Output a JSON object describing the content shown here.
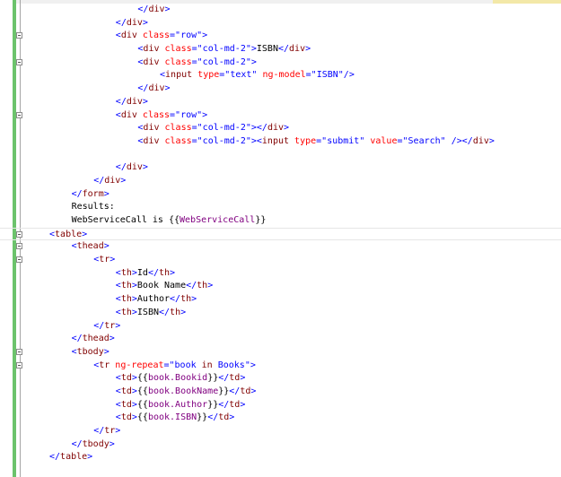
{
  "colors": {
    "tag_delimiter": "#0000ff",
    "tag_name": "#800000",
    "attribute": "#ff0000",
    "attribute_value": "#0000ff",
    "text": "#000000",
    "binding": "#800080",
    "change_bar": "#6cc36c"
  },
  "fold_icon": "collapse-box-icon",
  "lines": [
    {
      "indent": 8,
      "fold": false,
      "tokens": [
        [
          "t",
          "</"
        ],
        [
          "tag",
          "div"
        ],
        [
          "t",
          ">"
        ]
      ]
    },
    {
      "indent": 6,
      "fold": false,
      "tokens": [
        [
          "t",
          "</"
        ],
        [
          "tag",
          "div"
        ],
        [
          "t",
          ">"
        ]
      ]
    },
    {
      "indent": 6,
      "fold": true,
      "tokens": [
        [
          "t",
          "<"
        ],
        [
          "tag",
          "div"
        ],
        [
          "txt",
          " "
        ],
        [
          "attr",
          "class"
        ],
        [
          "t",
          "=\""
        ],
        [
          "val",
          "row"
        ],
        [
          "t",
          "\">"
        ]
      ]
    },
    {
      "indent": 8,
      "fold": false,
      "tokens": [
        [
          "t",
          "<"
        ],
        [
          "tag",
          "div"
        ],
        [
          "txt",
          " "
        ],
        [
          "attr",
          "class"
        ],
        [
          "t",
          "=\""
        ],
        [
          "val",
          "col-md-2"
        ],
        [
          "t",
          "\">"
        ],
        [
          "txt",
          "ISBN"
        ],
        [
          "t",
          "</"
        ],
        [
          "tag",
          "div"
        ],
        [
          "t",
          ">"
        ]
      ]
    },
    {
      "indent": 8,
      "fold": true,
      "tokens": [
        [
          "t",
          "<"
        ],
        [
          "tag",
          "div"
        ],
        [
          "txt",
          " "
        ],
        [
          "attr",
          "class"
        ],
        [
          "t",
          "=\""
        ],
        [
          "val",
          "col-md-2"
        ],
        [
          "t",
          "\">"
        ]
      ]
    },
    {
      "indent": 10,
      "fold": false,
      "tokens": [
        [
          "t",
          "<"
        ],
        [
          "tag",
          "input"
        ],
        [
          "txt",
          " "
        ],
        [
          "attr",
          "type"
        ],
        [
          "t",
          "=\""
        ],
        [
          "val",
          "text"
        ],
        [
          "t",
          "\""
        ],
        [
          "txt",
          " "
        ],
        [
          "attr",
          "ng-model"
        ],
        [
          "t",
          "=\""
        ],
        [
          "val",
          "ISBN"
        ],
        [
          "t",
          "\"/>"
        ]
      ]
    },
    {
      "indent": 8,
      "fold": false,
      "tokens": [
        [
          "t",
          "</"
        ],
        [
          "tag",
          "div"
        ],
        [
          "t",
          ">"
        ]
      ]
    },
    {
      "indent": 6,
      "fold": false,
      "tokens": [
        [
          "t",
          "</"
        ],
        [
          "tag",
          "div"
        ],
        [
          "t",
          ">"
        ]
      ]
    },
    {
      "indent": 6,
      "fold": true,
      "tokens": [
        [
          "t",
          "<"
        ],
        [
          "tag",
          "div"
        ],
        [
          "txt",
          " "
        ],
        [
          "attr",
          "class"
        ],
        [
          "t",
          "=\""
        ],
        [
          "val",
          "row"
        ],
        [
          "t",
          "\">"
        ]
      ]
    },
    {
      "indent": 8,
      "fold": false,
      "tokens": [
        [
          "t",
          "<"
        ],
        [
          "tag",
          "div"
        ],
        [
          "txt",
          " "
        ],
        [
          "attr",
          "class"
        ],
        [
          "t",
          "=\""
        ],
        [
          "val",
          "col-md-2"
        ],
        [
          "t",
          "\"></"
        ],
        [
          "tag",
          "div"
        ],
        [
          "t",
          ">"
        ]
      ]
    },
    {
      "indent": 8,
      "fold": false,
      "tokens": [
        [
          "t",
          "<"
        ],
        [
          "tag",
          "div"
        ],
        [
          "txt",
          " "
        ],
        [
          "attr",
          "class"
        ],
        [
          "t",
          "=\""
        ],
        [
          "val",
          "col-md-2"
        ],
        [
          "t",
          "\"><"
        ],
        [
          "tag",
          "input"
        ],
        [
          "txt",
          " "
        ],
        [
          "attr",
          "type"
        ],
        [
          "t",
          "=\""
        ],
        [
          "val",
          "submit"
        ],
        [
          "t",
          "\""
        ],
        [
          "txt",
          " "
        ],
        [
          "attr",
          "value"
        ],
        [
          "t",
          "=\""
        ],
        [
          "val",
          "Search"
        ],
        [
          "t",
          "\""
        ],
        [
          "txt",
          " "
        ],
        [
          "t",
          "/></"
        ],
        [
          "tag",
          "div"
        ],
        [
          "t",
          ">"
        ]
      ]
    },
    {
      "indent": 0,
      "fold": false,
      "tokens": []
    },
    {
      "indent": 6,
      "fold": false,
      "tokens": [
        [
          "t",
          "</"
        ],
        [
          "tag",
          "div"
        ],
        [
          "t",
          ">"
        ]
      ]
    },
    {
      "indent": 4,
      "fold": false,
      "tokens": [
        [
          "t",
          "</"
        ],
        [
          "tag",
          "div"
        ],
        [
          "t",
          ">"
        ]
      ]
    },
    {
      "indent": 2,
      "fold": false,
      "tokens": [
        [
          "t",
          "</"
        ],
        [
          "tag",
          "form"
        ],
        [
          "t",
          ">"
        ]
      ]
    },
    {
      "indent": 2,
      "fold": false,
      "tokens": [
        [
          "txt",
          "Results:"
        ]
      ]
    },
    {
      "indent": 2,
      "fold": false,
      "tokens": [
        [
          "txt",
          "WebServiceCall is {{"
        ],
        [
          "bind",
          "WebServiceCall"
        ],
        [
          "txt",
          "}}"
        ]
      ]
    },
    {
      "indent": 0,
      "fold": true,
      "current": true,
      "tokens": [
        [
          "t",
          "<"
        ],
        [
          "tag",
          "table"
        ],
        [
          "t",
          ">"
        ]
      ]
    },
    {
      "indent": 2,
      "fold": true,
      "tokens": [
        [
          "t",
          "<"
        ],
        [
          "tag",
          "thead"
        ],
        [
          "t",
          ">"
        ]
      ]
    },
    {
      "indent": 4,
      "fold": true,
      "tokens": [
        [
          "t",
          "<"
        ],
        [
          "tag",
          "tr"
        ],
        [
          "t",
          ">"
        ]
      ]
    },
    {
      "indent": 6,
      "fold": false,
      "tokens": [
        [
          "t",
          "<"
        ],
        [
          "tag",
          "th"
        ],
        [
          "t",
          ">"
        ],
        [
          "txt",
          "Id"
        ],
        [
          "t",
          "</"
        ],
        [
          "tag",
          "th"
        ],
        [
          "t",
          ">"
        ]
      ]
    },
    {
      "indent": 6,
      "fold": false,
      "tokens": [
        [
          "t",
          "<"
        ],
        [
          "tag",
          "th"
        ],
        [
          "t",
          ">"
        ],
        [
          "txt",
          "Book Name"
        ],
        [
          "t",
          "</"
        ],
        [
          "tag",
          "th"
        ],
        [
          "t",
          ">"
        ]
      ]
    },
    {
      "indent": 6,
      "fold": false,
      "tokens": [
        [
          "t",
          "<"
        ],
        [
          "tag",
          "th"
        ],
        [
          "t",
          ">"
        ],
        [
          "txt",
          "Author"
        ],
        [
          "t",
          "</"
        ],
        [
          "tag",
          "th"
        ],
        [
          "t",
          ">"
        ]
      ]
    },
    {
      "indent": 6,
      "fold": false,
      "tokens": [
        [
          "t",
          "<"
        ],
        [
          "tag",
          "th"
        ],
        [
          "t",
          ">"
        ],
        [
          "txt",
          "ISBN"
        ],
        [
          "t",
          "</"
        ],
        [
          "tag",
          "th"
        ],
        [
          "t",
          ">"
        ]
      ]
    },
    {
      "indent": 4,
      "fold": false,
      "tokens": [
        [
          "t",
          "</"
        ],
        [
          "tag",
          "tr"
        ],
        [
          "t",
          ">"
        ]
      ]
    },
    {
      "indent": 2,
      "fold": false,
      "tokens": [
        [
          "t",
          "</"
        ],
        [
          "tag",
          "thead"
        ],
        [
          "t",
          ">"
        ]
      ]
    },
    {
      "indent": 2,
      "fold": true,
      "tokens": [
        [
          "t",
          "<"
        ],
        [
          "tag",
          "tbody"
        ],
        [
          "t",
          ">"
        ]
      ]
    },
    {
      "indent": 4,
      "fold": true,
      "tokens": [
        [
          "t",
          "<"
        ],
        [
          "tag",
          "tr"
        ],
        [
          "txt",
          " "
        ],
        [
          "attr",
          "ng-repeat"
        ],
        [
          "t",
          "=\""
        ],
        [
          "val",
          "book "
        ],
        [
          "tag",
          "in"
        ],
        [
          "val",
          " Books"
        ],
        [
          "t",
          "\">"
        ]
      ]
    },
    {
      "indent": 6,
      "fold": false,
      "tokens": [
        [
          "t",
          "<"
        ],
        [
          "tag",
          "td"
        ],
        [
          "t",
          ">"
        ],
        [
          "txt",
          "{{"
        ],
        [
          "bind",
          "book.Bookid"
        ],
        [
          "txt",
          "}}"
        ],
        [
          "t",
          "</"
        ],
        [
          "tag",
          "td"
        ],
        [
          "t",
          ">"
        ]
      ]
    },
    {
      "indent": 6,
      "fold": false,
      "tokens": [
        [
          "t",
          "<"
        ],
        [
          "tag",
          "td"
        ],
        [
          "t",
          ">"
        ],
        [
          "txt",
          "{{"
        ],
        [
          "bind",
          "book.BookName"
        ],
        [
          "txt",
          "}}"
        ],
        [
          "t",
          "</"
        ],
        [
          "tag",
          "td"
        ],
        [
          "t",
          ">"
        ]
      ]
    },
    {
      "indent": 6,
      "fold": false,
      "tokens": [
        [
          "t",
          "<"
        ],
        [
          "tag",
          "td"
        ],
        [
          "t",
          ">"
        ],
        [
          "txt",
          "{{"
        ],
        [
          "bind",
          "book.Author"
        ],
        [
          "txt",
          "}}"
        ],
        [
          "t",
          "</"
        ],
        [
          "tag",
          "td"
        ],
        [
          "t",
          ">"
        ]
      ]
    },
    {
      "indent": 6,
      "fold": false,
      "tokens": [
        [
          "t",
          "<"
        ],
        [
          "tag",
          "td"
        ],
        [
          "t",
          ">"
        ],
        [
          "txt",
          "{{"
        ],
        [
          "bind",
          "book.ISBN"
        ],
        [
          "txt",
          "}}"
        ],
        [
          "t",
          "</"
        ],
        [
          "tag",
          "td"
        ],
        [
          "t",
          ">"
        ]
      ]
    },
    {
      "indent": 4,
      "fold": false,
      "tokens": [
        [
          "t",
          "</"
        ],
        [
          "tag",
          "tr"
        ],
        [
          "t",
          ">"
        ]
      ]
    },
    {
      "indent": 2,
      "fold": false,
      "tokens": [
        [
          "t",
          "</"
        ],
        [
          "tag",
          "tbody"
        ],
        [
          "t",
          ">"
        ]
      ]
    },
    {
      "indent": 0,
      "fold": false,
      "tokens": [
        [
          "t",
          "</"
        ],
        [
          "tag",
          "table"
        ],
        [
          "t",
          ">"
        ]
      ]
    }
  ]
}
